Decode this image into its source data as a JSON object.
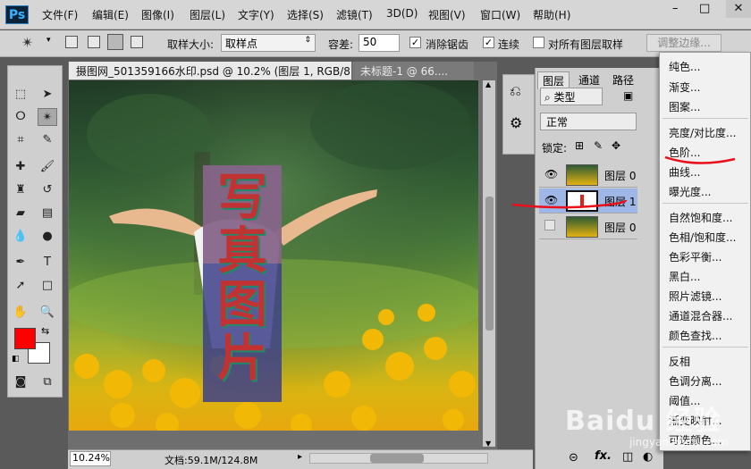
{
  "app": {
    "logo": "Ps"
  },
  "menubar": {
    "items": [
      "文件(F)",
      "编辑(E)",
      "图像(I)",
      "图层(L)",
      "文字(Y)",
      "选择(S)",
      "滤镜(T)",
      "3D(D)",
      "视图(V)",
      "窗口(W)",
      "帮助(H)"
    ]
  },
  "window_controls": {
    "minimize": "–",
    "maximize": "□",
    "close": "✕"
  },
  "options_bar": {
    "sample_size_label": "取样大小:",
    "sample_size_value": "取样点",
    "tolerance_label": "容差:",
    "tolerance_value": "50",
    "antialias_label": "消除锯齿",
    "antialias_checked": true,
    "contiguous_label": "连续",
    "contiguous_checked": true,
    "all_layers_label": "对所有图层取样",
    "all_layers_checked": false,
    "refine_edge_label": "调整边缘..."
  },
  "document_tabs": [
    {
      "label": "摄图网_501359166水印.psd @ 10.2% (图层 1, RGB/8)",
      "active": true
    },
    {
      "label": "未标题-1 @ 66....",
      "active": false
    }
  ],
  "canvas_text": "写真图片",
  "status_bar": {
    "zoom": "10.24%",
    "doc_info": "文档:59.1M/124.8M"
  },
  "layers_panel": {
    "tabs": [
      "图层",
      "通道",
      "路径"
    ],
    "filter_label": "类型",
    "blend_mode": "正常",
    "lock_label": "锁定:",
    "layers": [
      {
        "name": "图层 0",
        "visible": true,
        "selected": false
      },
      {
        "name": "图层 1",
        "visible": true,
        "selected": true
      },
      {
        "name": "图层 0",
        "visible": false,
        "selected": false
      }
    ]
  },
  "adjustment_menu": {
    "groups": [
      [
        "纯色...",
        "渐变...",
        "图案..."
      ],
      [
        "亮度/对比度...",
        "色阶...",
        "曲线...",
        "曝光度..."
      ],
      [
        "自然饱和度...",
        "色相/饱和度...",
        "色彩平衡...",
        "黑白...",
        "照片滤镜...",
        "通道混合器...",
        "颜色查找..."
      ],
      [
        "反相",
        "色调分离...",
        "阈值...",
        "渐变映射...",
        "可选颜色..."
      ]
    ]
  },
  "colors": {
    "foreground": "#ff0000",
    "background": "#ffffff",
    "annotation": "#e8101a"
  },
  "watermark": {
    "text": "Baidu 经验",
    "url_text": "jingyan.baidu.com"
  }
}
